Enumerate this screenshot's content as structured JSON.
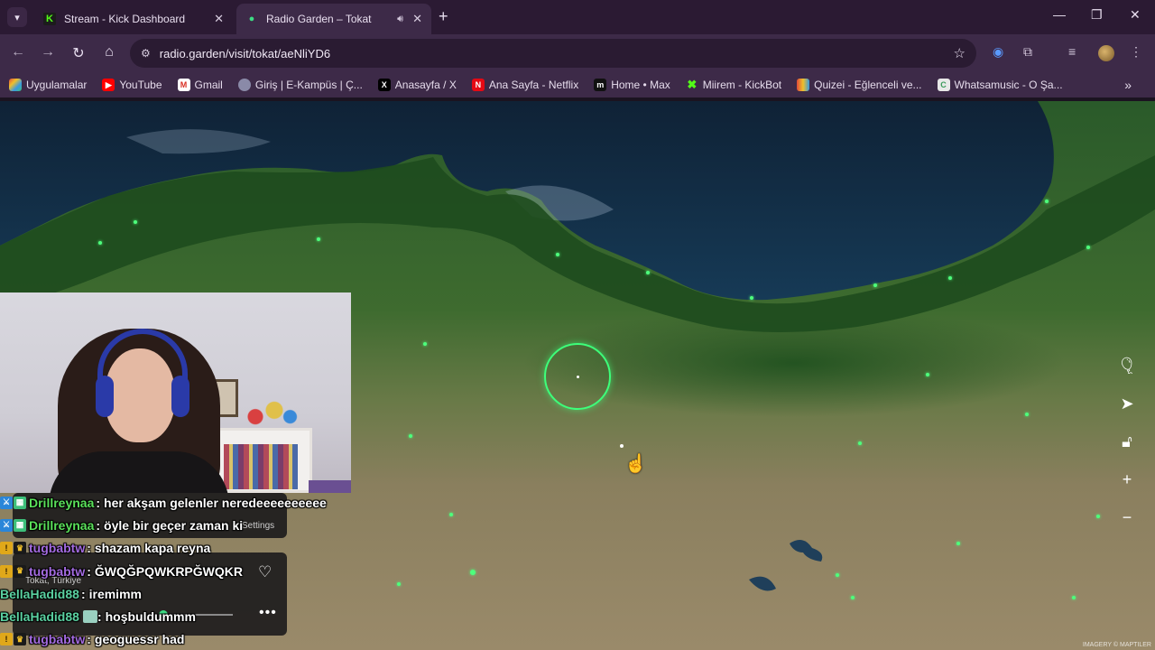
{
  "browser": {
    "tabs": [
      {
        "title": "Stream - Kick Dashboard",
        "favicon": "kick-icon",
        "active": false
      },
      {
        "title": "Radio Garden – Tokat",
        "favicon": "radio-garden-icon",
        "active": true,
        "audio": true
      }
    ],
    "url": "radio.garden/visit/tokat/aeNliYD6",
    "bookmarks": [
      {
        "label": "Uygulamalar",
        "icon": "apps-grid-icon",
        "color": "#e04a3a"
      },
      {
        "label": "YouTube",
        "icon": "youtube-icon",
        "color": "#ff0000"
      },
      {
        "label": "Gmail",
        "icon": "gmail-icon",
        "color": "#d93025"
      },
      {
        "label": "Giriş | E-Kampüs | Ç...",
        "icon": "campus-icon",
        "color": "#6a6a8a"
      },
      {
        "label": "Anasayfa / X",
        "icon": "x-icon",
        "color": "#000000"
      },
      {
        "label": "Ana Sayfa - Netflix",
        "icon": "netflix-icon",
        "color": "#e50914"
      },
      {
        "label": "Home • Max",
        "icon": "max-icon",
        "color": "#111111"
      },
      {
        "label": "Miirem - KickBot",
        "icon": "kickbot-icon",
        "color": "#53fc18"
      },
      {
        "label": "Quizei - Eğlenceli ve...",
        "icon": "quizei-icon",
        "color": "#e0a81a"
      },
      {
        "label": "Whatsamusic - O Şa...",
        "icon": "whatsamusic-icon",
        "color": "#3a9a5a"
      }
    ]
  },
  "radio_garden": {
    "location_label": "Tokat, Türkiye",
    "settings_label": "Settings",
    "imagery_credit": "IMAGERY © MAPTILER",
    "accent_color": "#3dff7a"
  },
  "chat": [
    {
      "user": "Drillreynaa",
      "user_color": "#5ae05a",
      "badges": [
        "mod",
        "sub"
      ],
      "message": "her akşam gelenler neredeeeeeeeeee"
    },
    {
      "user": "Drillreynaa",
      "user_color": "#5ae05a",
      "badges": [
        "mod",
        "sub"
      ],
      "message": "öyle bir geçer zaman ki"
    },
    {
      "user": "tugbabtw",
      "user_color": "#a36be0",
      "badges": [
        "gift",
        "crown"
      ],
      "message": "shazam kapa reyna"
    },
    {
      "user": "tugbabtw",
      "user_color": "#a36be0",
      "badges": [
        "gift",
        "crown"
      ],
      "message": "ĞWQĞPQWKRPĞWQKR"
    },
    {
      "user": "BellaHadid88",
      "user_color": "#5ad0a0",
      "badges": [],
      "message": "iremimm"
    },
    {
      "user": "BellaHadid88",
      "user_color": "#5ad0a0",
      "badges": [],
      "message": "hoşbuldummm"
    },
    {
      "user": "tugbabtw",
      "user_color": "#a36be0",
      "badges": [
        "gift",
        "crown"
      ],
      "message": "geoguessr had"
    }
  ]
}
